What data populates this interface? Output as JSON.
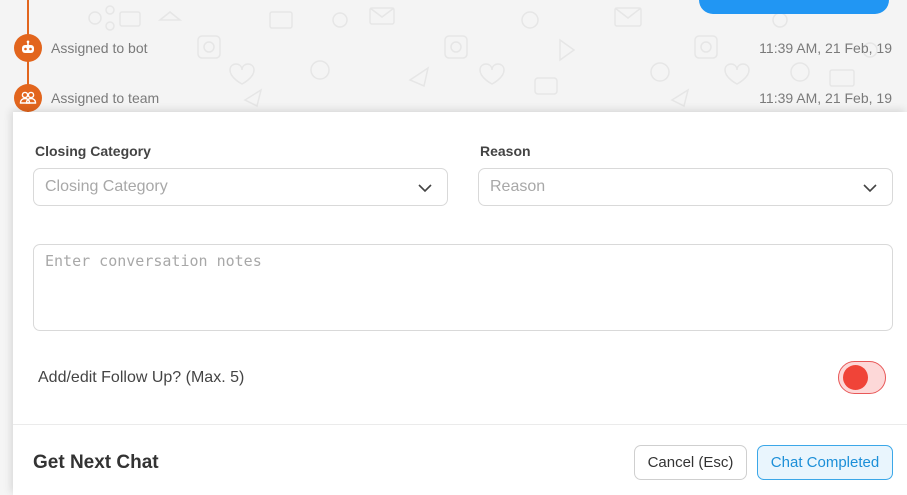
{
  "timeline": {
    "events": [
      {
        "label": "Assigned to bot",
        "icon": "robot-icon",
        "time": "11:39 AM, 21 Feb, 19"
      },
      {
        "label": "Assigned to team",
        "icon": "team-icon",
        "time": "11:39 AM, 21 Feb, 19"
      }
    ],
    "accent_color": "#e2651d",
    "bubble_color": "#2196f3"
  },
  "close_form": {
    "closing_category": {
      "label": "Closing Category",
      "placeholder": "Closing Category"
    },
    "reason": {
      "label": "Reason",
      "placeholder": "Reason"
    },
    "notes": {
      "placeholder": "Enter conversation notes"
    },
    "follow_up": {
      "label": "Add/edit Follow Up? (Max. 5)",
      "toggle_color": "#f04438"
    }
  },
  "footer": {
    "next_chat_label": "Get Next Chat",
    "cancel_label": "Cancel (Esc)",
    "complete_label": "Chat Completed",
    "complete_color": "#1c8fd8"
  }
}
